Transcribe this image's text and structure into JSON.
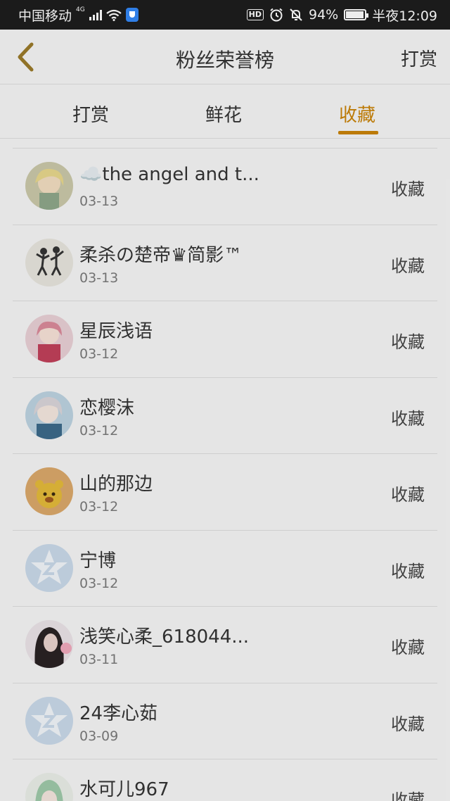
{
  "status_bar": {
    "carrier": "中国移动",
    "network": "4G",
    "battery_percent": "94%",
    "time": "半夜12:09",
    "hd_label": "HD"
  },
  "header": {
    "title": "粉丝荣誉榜",
    "right_action": "打赏"
  },
  "tabs": [
    {
      "label": "打赏",
      "active": false
    },
    {
      "label": "鲜花",
      "active": false
    },
    {
      "label": "收藏",
      "active": true
    }
  ],
  "accent_color": "#c88208",
  "entries": [
    {
      "name": "☁️the angel and t...",
      "date": "03-13",
      "action": "收藏",
      "avatar": "anime-girl-avatar-1"
    },
    {
      "name": "柔杀の楚帝♛简影™",
      "date": "03-13",
      "action": "收藏",
      "avatar": "couple-silhouette-avatar"
    },
    {
      "name": "星辰浅语",
      "date": "03-12",
      "action": "收藏",
      "avatar": "anime-girl-pink-avatar"
    },
    {
      "name": "恋樱沫",
      "date": "03-12",
      "action": "收藏",
      "avatar": "anime-girl-blue-avatar"
    },
    {
      "name": "山的那边",
      "date": "03-12",
      "action": "收藏",
      "avatar": "cartoon-bear-avatar"
    },
    {
      "name": "宁博",
      "date": "03-12",
      "action": "收藏",
      "avatar": "default-star-avatar"
    },
    {
      "name": "浅笑心柔_618044...",
      "date": "03-11",
      "action": "收藏",
      "avatar": "dark-hair-girl-avatar"
    },
    {
      "name": "24李心茹",
      "date": "03-09",
      "action": "收藏",
      "avatar": "default-star-avatar"
    },
    {
      "name": "水可儿967",
      "date": "",
      "action": "收藏",
      "avatar": "green-hair-avatar"
    }
  ]
}
